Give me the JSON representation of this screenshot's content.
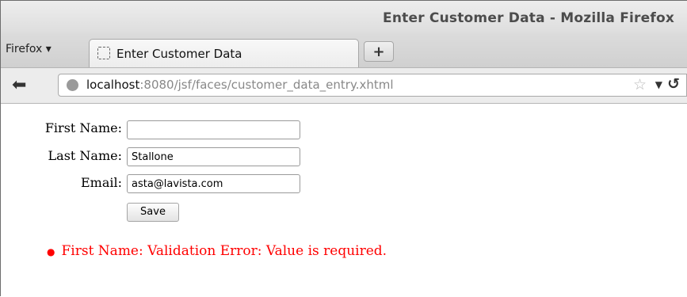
{
  "window": {
    "title": "Enter Customer Data - Mozilla Firefox"
  },
  "browser": {
    "menu_label": "Firefox ▾",
    "tab": {
      "label": "Enter Customer Data"
    },
    "new_tab_label": "+",
    "url_host": "localhost",
    "url_rest": ":8080/jsf/faces/customer_data_entry.xhtml"
  },
  "form": {
    "first_name_label": "First Name:",
    "first_name_value": "",
    "last_name_label": "Last Name:",
    "last_name_value": "Stallone",
    "email_label": "Email:",
    "email_value": "asta@lavista.com",
    "save_label": "Save"
  },
  "errors": [
    "First Name: Validation Error: Value is required."
  ],
  "colors": {
    "error": "#ff0000"
  }
}
